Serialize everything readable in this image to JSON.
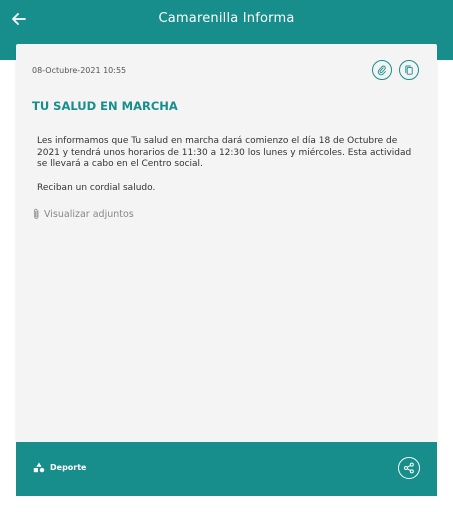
{
  "header": {
    "title": "Camarenilla Informa",
    "back_icon": "arrow-left-icon"
  },
  "news": {
    "date": "08-Octubre-2021 10:55",
    "title": "TU SALUD EN MARCHA",
    "paragraphs": [
      "Les informamos que Tu salud en marcha dará comienzo el día 18 de Octubre de 2021 y tendrá unos horarios de 11:30 a 12:30 los lunes y miércoles. Esta actividad se llevará a cabo en el Centro social.",
      "Reciban un cordial saludo."
    ],
    "attachments_label": "Visualizar adjuntos",
    "actions": {
      "attach_icon": "paperclip-icon",
      "copy_icon": "copy-icon"
    }
  },
  "footer": {
    "category": "Deporte",
    "category_icon": "shapes-icon",
    "share_icon": "share-icon"
  },
  "colors": {
    "primary": "#188e8c",
    "card_background": "#f4f4f4",
    "text": "#333333",
    "muted_text": "#888888"
  }
}
